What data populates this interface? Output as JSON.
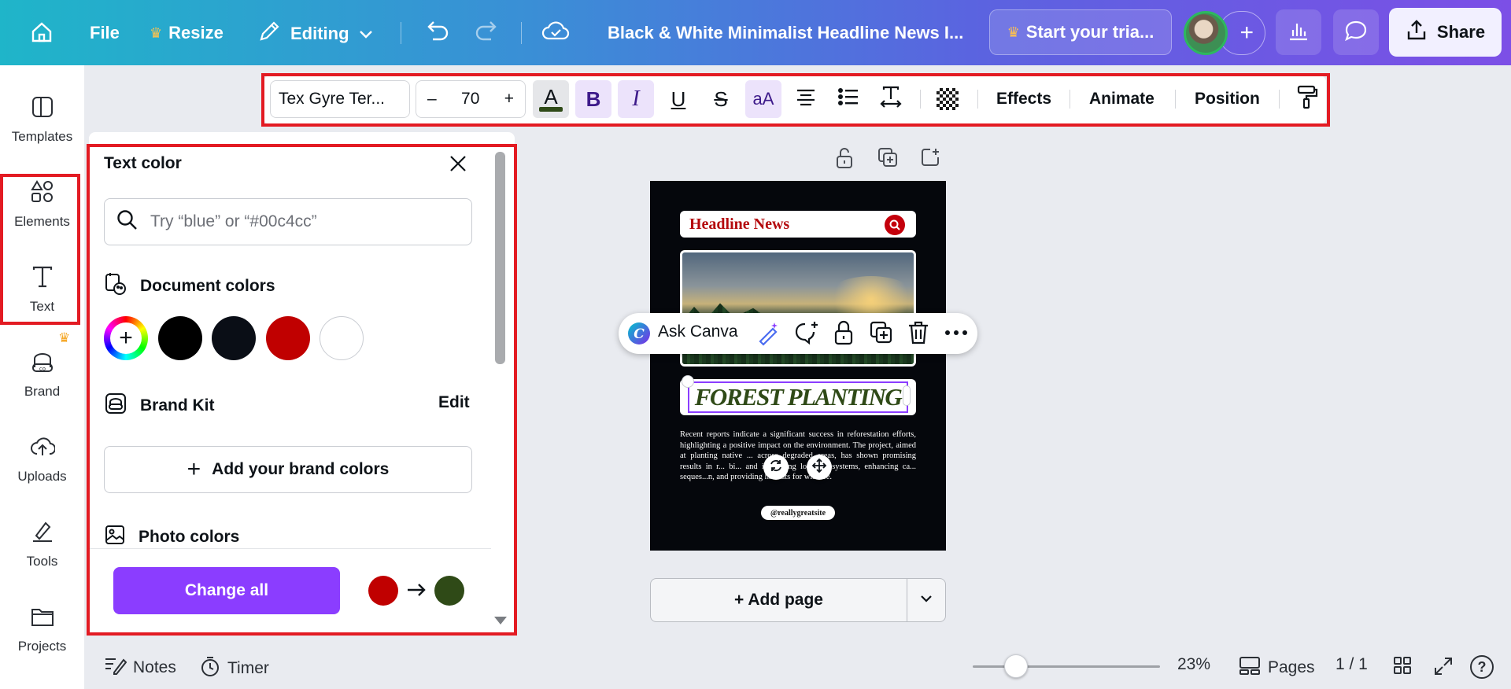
{
  "topbar": {
    "file_label": "File",
    "resize_label": "Resize",
    "editing_label": "Editing",
    "doc_title": "Black & White Minimalist Headline News I...",
    "trial_label": "Start your tria...",
    "share_label": "Share"
  },
  "rail": {
    "items": [
      {
        "label": "Templates",
        "icon": "templates-icon"
      },
      {
        "label": "Elements",
        "icon": "elements-icon"
      },
      {
        "label": "Text",
        "icon": "text-icon"
      },
      {
        "label": "Brand",
        "icon": "brand-icon"
      },
      {
        "label": "Uploads",
        "icon": "uploads-icon"
      },
      {
        "label": "Tools",
        "icon": "tools-icon"
      },
      {
        "label": "Projects",
        "icon": "projects-icon"
      }
    ]
  },
  "toolbar": {
    "font": "Tex Gyre Ter...",
    "size": "70",
    "text_color": "#2f4a17",
    "effects_label": "Effects",
    "animate_label": "Animate",
    "position_label": "Position"
  },
  "color_panel": {
    "title": "Text color",
    "search_placeholder": "Try “blue” or “#00c4cc”",
    "document_colors_label": "Document colors",
    "document_colors": [
      "#000000",
      "#0a0e16",
      "#c00000",
      "#ffffff"
    ],
    "brand_kit_label": "Brand Kit",
    "edit_label": "Edit",
    "add_brand_label": "Add your brand colors",
    "photo_colors_label": "Photo colors",
    "change_all_label": "Change all",
    "change_from": "#c00000",
    "change_to": "#2f4a17"
  },
  "design": {
    "headline": "Headline News",
    "title": "FOREST PLANTING",
    "body": "Recent reports indicate a significant success in reforestation efforts, highlighting a positive impact on the environment. The project, aimed at planting native ... across degraded areas, has shown promising results in r... bi... and improving local ecosystems, enhancing ca... seques...n, and providing habitats for wildlife.",
    "site": "@reallygreatsite"
  },
  "context_menu": {
    "ask_label": "Ask Canva"
  },
  "canvas": {
    "add_page_label": "+ Add page"
  },
  "bottom": {
    "notes_label": "Notes",
    "timer_label": "Timer",
    "zoom": "23%",
    "zoom_level": 0.23,
    "pages_label": "Pages",
    "page_count": "1 / 1",
    "help_label": "?"
  },
  "colors": {
    "accent": "#8b3dff",
    "highlight": "#e31b23"
  }
}
